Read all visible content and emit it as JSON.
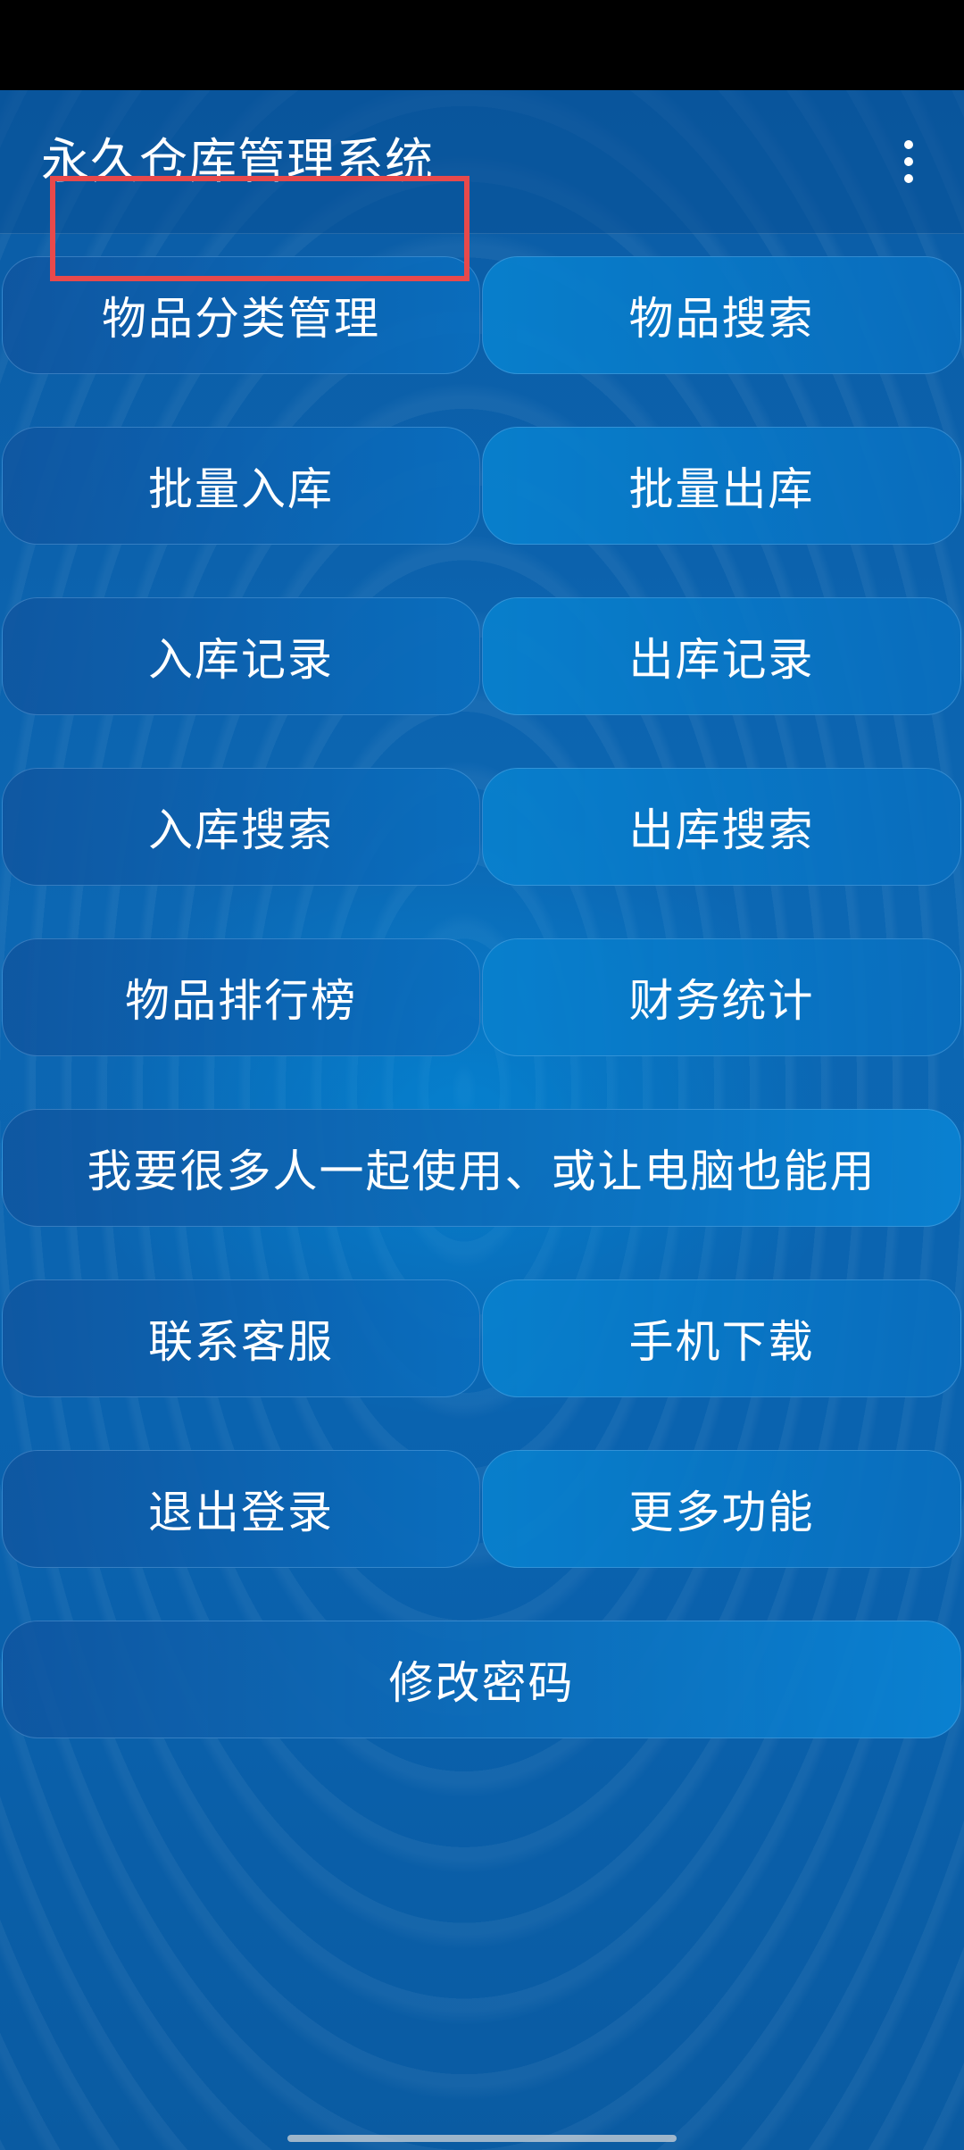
{
  "header": {
    "title": "永久仓库管理系统",
    "menu_icon": "more-vert-icon"
  },
  "buttons": {
    "item_category": "物品分类管理",
    "item_search": "物品搜索",
    "batch_inbound": "批量入库",
    "batch_outbound": "批量出库",
    "inbound_records": "入库记录",
    "outbound_records": "出库记录",
    "inbound_search": "入库搜索",
    "outbound_search": "出库搜索",
    "item_ranking": "物品排行榜",
    "financial_stats": "财务统计",
    "multi_user": "我要很多人一起使用、或让电脑也能用",
    "contact_support": "联系客服",
    "phone_download": "手机下载",
    "logout": "退出登录",
    "more_features": "更多功能",
    "change_password": "修改密码"
  },
  "colors": {
    "status_bar": "#000000",
    "background": "#0b5ca5",
    "button_text": "#ffffff",
    "highlight": "#e8494b"
  }
}
